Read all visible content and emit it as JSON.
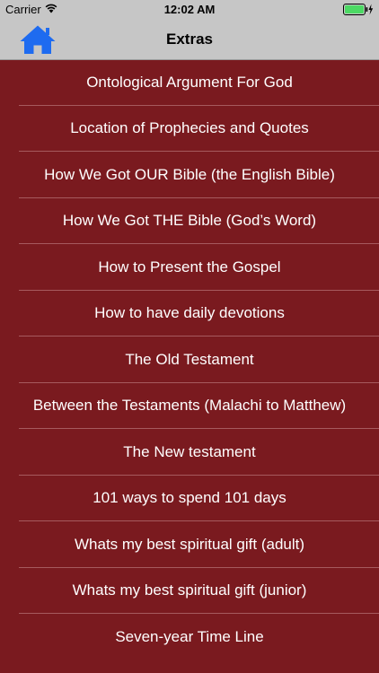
{
  "status_bar": {
    "carrier": "Carrier",
    "time": "12:02 AM",
    "wifi_icon": "wifi-icon",
    "battery_icon": "battery-charging-icon",
    "battery_color": "#4cd964"
  },
  "nav": {
    "title": "Extras",
    "home_icon": "home-icon",
    "home_color": "#1e6bf0",
    "background": "#c6c6c6"
  },
  "list": {
    "background": "#7a1a1f",
    "items": [
      "Ontological Argument For God",
      "Location of Prophecies and Quotes",
      "How We Got OUR Bible (the English Bible)",
      "How We Got THE Bible (God’s Word)",
      "How to Present the Gospel",
      "How to have daily devotions",
      "The Old Testament",
      "Between the Testaments (Malachi to Matthew)",
      "The New testament",
      "101 ways to spend 101 days",
      "Whats my best spiritual gift (adult)",
      "Whats my best spiritual gift (junior)",
      "Seven-year Time Line"
    ]
  }
}
